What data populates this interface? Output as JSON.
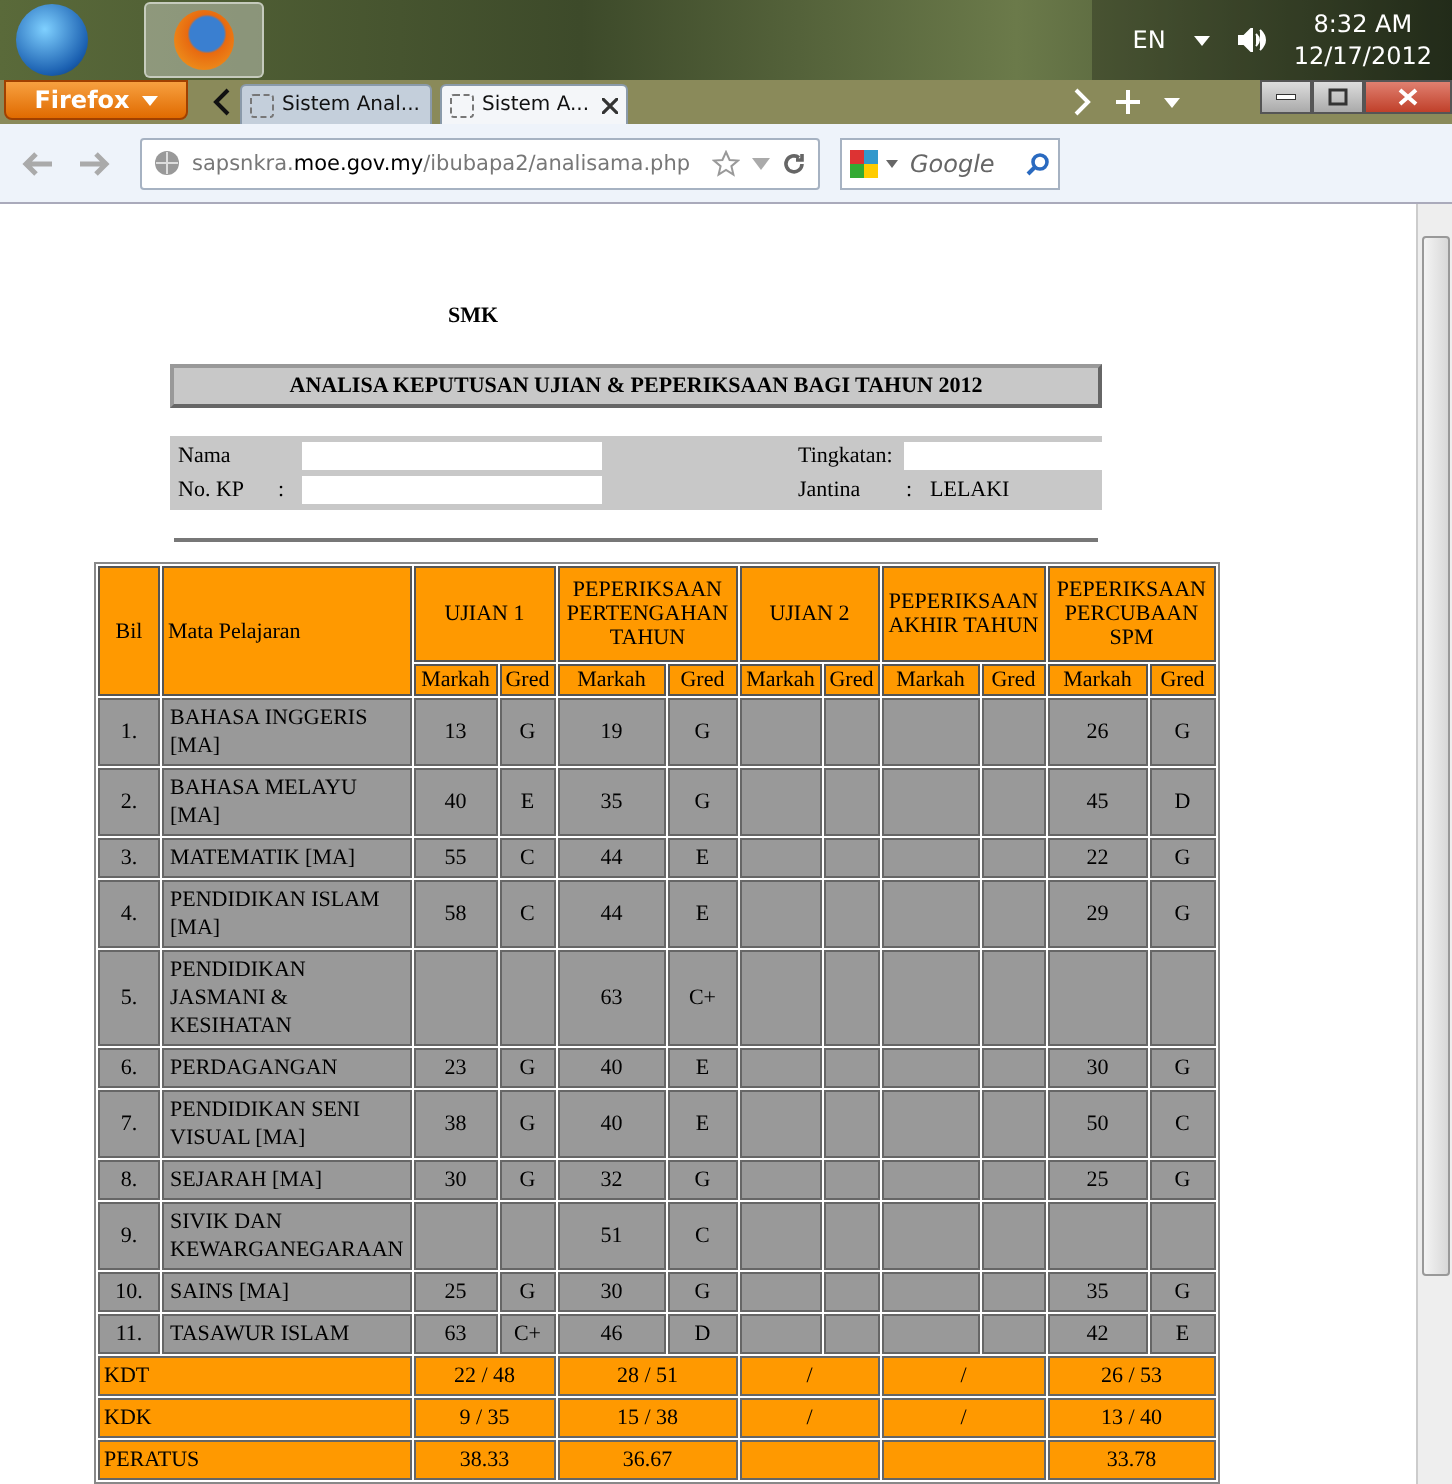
{
  "taskbar": {
    "language": "EN",
    "time": "8:32 AM",
    "date": "12/17/2012"
  },
  "browser": {
    "menu_button": "Firefox",
    "tabs": [
      {
        "title": "Sistem Anal...",
        "selected": false
      },
      {
        "title": "Sistem A...",
        "selected": true
      }
    ],
    "url": "sapsnkra.**moe.gov.my**/ibubapa2/analisama.php",
    "search": {
      "placeholder": "Google"
    }
  },
  "page": {
    "school": "SMK",
    "title": "ANALISA KEPUTUSAN UJIAN & PEPERIKSAAN BAGI TAHUN 2012",
    "info": [
      {
        "label": "Nama"
      },
      {
        "label": "Tingkatan",
        "separator": ":"
      },
      {
        "label": "No. KP",
        "separator": ":"
      },
      {
        "label": "Jantina",
        "separator": ":",
        "value": "LELAKI"
      }
    ],
    "table": {
      "col_bil": "Bil",
      "col_subject": "Mata Pelajaran",
      "exams": [
        {
          "title": "UJIAN 1",
          "mark": "Markah",
          "grade": "Gred"
        },
        {
          "title": "PEPERIKSAAN PERTENGAHAN TAHUN",
          "mark": "Markah",
          "grade": "Gred"
        },
        {
          "title": "UJIAN 2",
          "mark": "Markah",
          "grade": "Gred"
        },
        {
          "title": "PEPERIKSAAN AKHIR TAHUN",
          "mark": "Markah",
          "grade": "Gred"
        },
        {
          "title": "PEPERIKSAAN PERCUBAAN SPM",
          "mark": "Markah",
          "grade": "Gred"
        }
      ],
      "rows": [
        {
          "bil": "1.",
          "subject": "BAHASA INGGERIS [MA]",
          "scores": [
            {
              "kind": "score",
              "mark": "13",
              "grade": "G"
            },
            {
              "kind": "score",
              "mark": "19",
              "grade": "G"
            },
            {
              "kind": "empty"
            },
            {
              "kind": "empty"
            },
            {
              "kind": "score",
              "mark": "26",
              "grade": "G"
            }
          ]
        },
        {
          "bil": "2.",
          "subject": "BAHASA MELAYU [MA]",
          "scores": [
            {
              "kind": "score",
              "mark": "40",
              "grade": "E"
            },
            {
              "kind": "score",
              "mark": "35",
              "grade": "G"
            },
            {
              "kind": "empty"
            },
            {
              "kind": "empty"
            },
            {
              "kind": "score",
              "mark": "45",
              "grade": "D"
            }
          ]
        },
        {
          "bil": "3.",
          "subject": "MATEMATIK [MA]",
          "scores": [
            {
              "kind": "score",
              "mark": "55",
              "grade": "C"
            },
            {
              "kind": "score",
              "mark": "44",
              "grade": "E"
            },
            {
              "kind": "empty"
            },
            {
              "kind": "empty"
            },
            {
              "kind": "score",
              "mark": "22",
              "grade": "G"
            }
          ]
        },
        {
          "bil": "4.",
          "subject": "PENDIDIKAN ISLAM [MA]",
          "scores": [
            {
              "kind": "score",
              "mark": "58",
              "grade": "C"
            },
            {
              "kind": "score",
              "mark": "44",
              "grade": "E"
            },
            {
              "kind": "empty"
            },
            {
              "kind": "empty"
            },
            {
              "kind": "score",
              "mark": "29",
              "grade": "G"
            }
          ]
        },
        {
          "bil": "5.",
          "subject": "PENDIDIKAN JASMANI & KESIHATAN",
          "scores": [
            {
              "kind": "empty"
            },
            {
              "kind": "score",
              "mark": "63",
              "grade": "C+"
            },
            {
              "kind": "empty"
            },
            {
              "kind": "empty"
            },
            {
              "kind": "empty"
            }
          ]
        },
        {
          "bil": "6.",
          "subject": "PERDAGANGAN",
          "scores": [
            {
              "kind": "score",
              "mark": "23",
              "grade": "G"
            },
            {
              "kind": "score",
              "mark": "40",
              "grade": "E"
            },
            {
              "kind": "empty"
            },
            {
              "kind": "empty"
            },
            {
              "kind": "score",
              "mark": "30",
              "grade": "G"
            }
          ]
        },
        {
          "bil": "7.",
          "subject": "PENDIDIKAN SENI VISUAL [MA]",
          "scores": [
            {
              "kind": "score",
              "mark": "38",
              "grade": "G"
            },
            {
              "kind": "score",
              "mark": "40",
              "grade": "E"
            },
            {
              "kind": "empty"
            },
            {
              "kind": "empty"
            },
            {
              "kind": "score",
              "mark": "50",
              "grade": "C"
            }
          ]
        },
        {
          "bil": "8.",
          "subject": "SEJARAH [MA]",
          "scores": [
            {
              "kind": "score",
              "mark": "30",
              "grade": "G"
            },
            {
              "kind": "score",
              "mark": "32",
              "grade": "G"
            },
            {
              "kind": "empty"
            },
            {
              "kind": "empty"
            },
            {
              "kind": "score",
              "mark": "25",
              "grade": "G"
            }
          ]
        },
        {
          "bil": "9.",
          "subject": "SIVIK DAN KEWARGANEGARAAN",
          "scores": [
            {
              "kind": "empty"
            },
            {
              "kind": "score",
              "mark": "51",
              "grade": "C"
            },
            {
              "kind": "empty"
            },
            {
              "kind": "empty"
            },
            {
              "kind": "empty"
            }
          ]
        },
        {
          "bil": "10.",
          "subject": "SAINS [MA]",
          "scores": [
            {
              "kind": "score",
              "mark": "25",
              "grade": "G"
            },
            {
              "kind": "score",
              "mark": "30",
              "grade": "G"
            },
            {
              "kind": "empty"
            },
            {
              "kind": "empty"
            },
            {
              "kind": "score",
              "mark": "35",
              "grade": "G"
            }
          ]
        },
        {
          "bil": "11.",
          "subject": "TASAWUR ISLAM",
          "scores": [
            {
              "kind": "score",
              "mark": "63",
              "grade": "C+"
            },
            {
              "kind": "score",
              "mark": "46",
              "grade": "D"
            },
            {
              "kind": "empty"
            },
            {
              "kind": "empty"
            },
            {
              "kind": "score",
              "mark": "42",
              "grade": "E"
            }
          ]
        }
      ],
      "summary": [
        {
          "label": "KDT",
          "values": [
            {
              "kind": "text",
              "text": "22 / 48"
            },
            {
              "kind": "text",
              "text": "28 / 51"
            },
            {
              "kind": "text",
              "text": "/"
            },
            {
              "kind": "text",
              "text": "/"
            },
            {
              "kind": "text",
              "text": "26 / 53"
            }
          ]
        },
        {
          "label": "KDK",
          "values": [
            {
              "kind": "text",
              "text": "9 / 35"
            },
            {
              "kind": "text",
              "text": "15 / 38"
            },
            {
              "kind": "text",
              "text": "/"
            },
            {
              "kind": "text",
              "text": "/"
            },
            {
              "kind": "text",
              "text": "13 / 40"
            }
          ]
        },
        {
          "label": "PERATUS",
          "values": [
            {
              "kind": "text",
              "text": "38.33"
            },
            {
              "kind": "text",
              "text": "36.67"
            },
            {
              "kind": "empty"
            },
            {
              "kind": "empty"
            },
            {
              "kind": "text",
              "text": "33.78"
            }
          ]
        }
      ]
    }
  }
}
